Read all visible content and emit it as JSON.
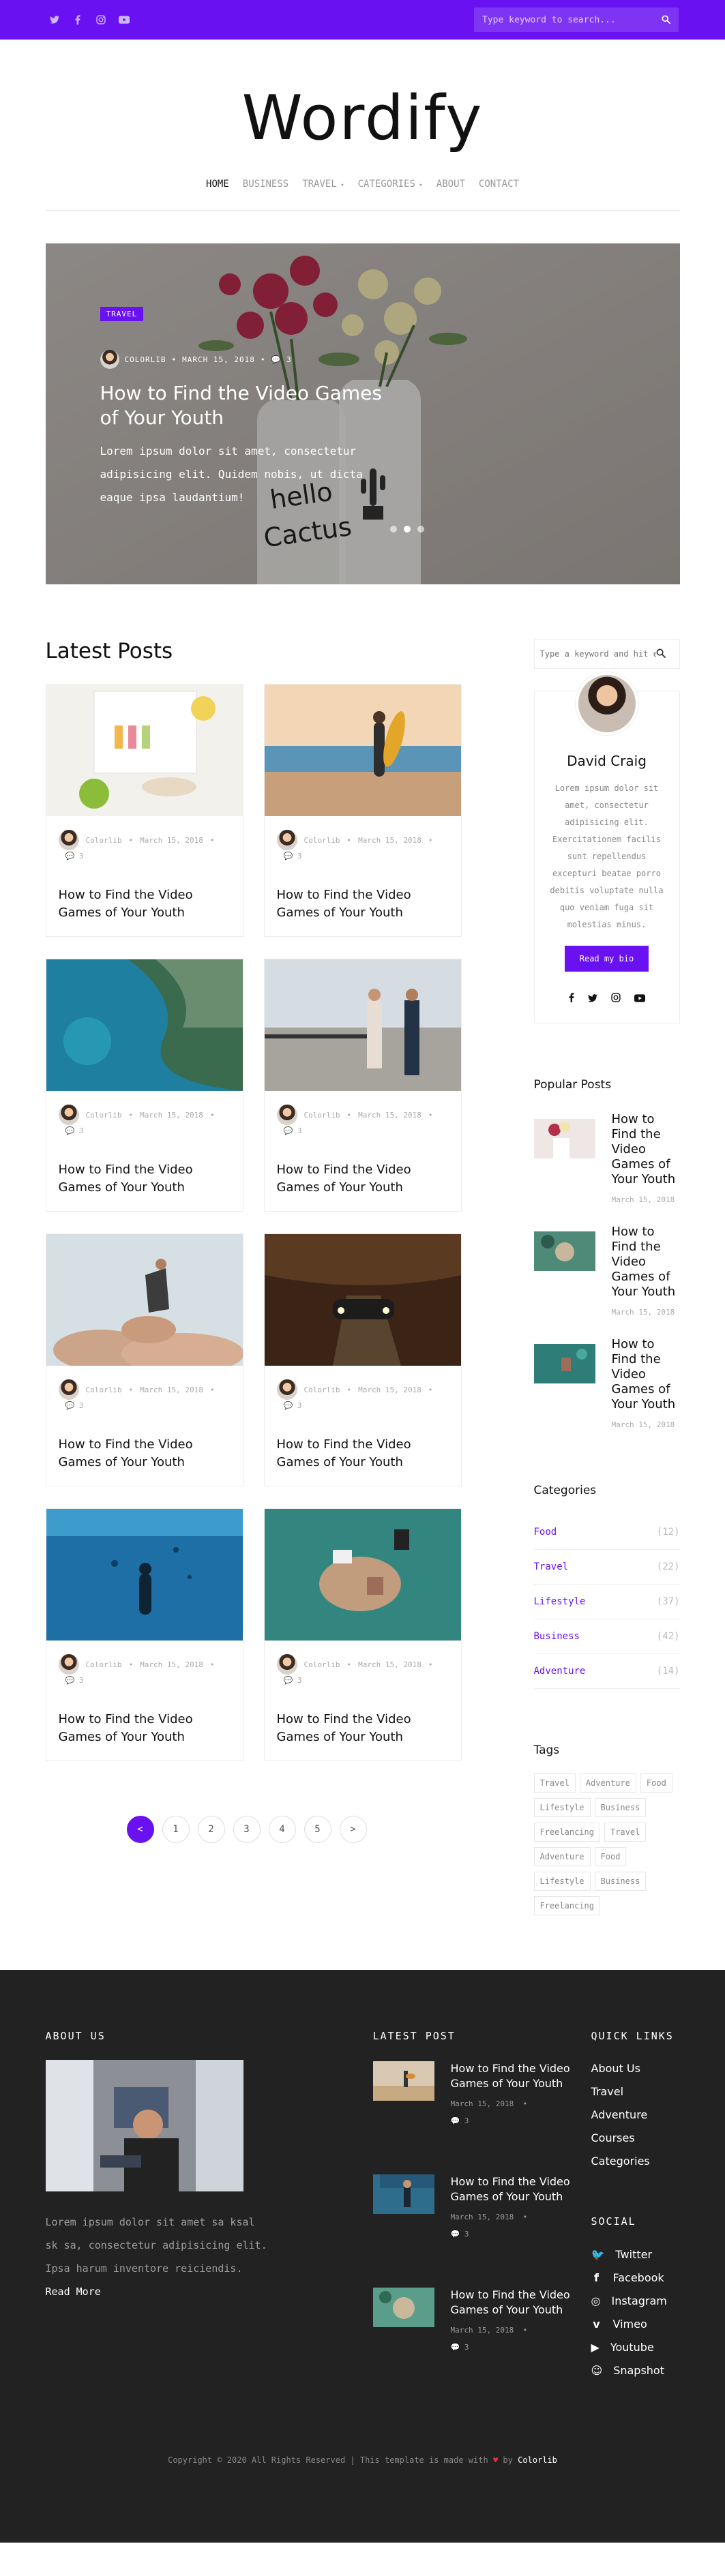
{
  "topbar": {
    "social": [
      "twitter-icon",
      "facebook-icon",
      "instagram-icon",
      "youtube-icon"
    ],
    "search_placeholder": "Type keyword to search..."
  },
  "logo": "Wordify",
  "nav": [
    {
      "label": "HOME",
      "active": true
    },
    {
      "label": "BUSINESS"
    },
    {
      "label": "TRAVEL",
      "dropdown": true
    },
    {
      "label": "CATEGORIES",
      "dropdown": true
    },
    {
      "label": "ABOUT"
    },
    {
      "label": "CONTACT"
    }
  ],
  "hero": {
    "badge": "TRAVEL",
    "author": "COLORLIB",
    "date": "MARCH 15, 2018",
    "comments": "3",
    "title": "How to Find the Video Games of Your Youth",
    "text": "Lorem ipsum dolor sit amet, consectetur adipisicing elit. Quidem nobis, ut dicta eaque ipsa laudantium!",
    "slides": 3,
    "active_slide": 2
  },
  "latest_posts": {
    "title": "Latest Posts",
    "posts": [
      {
        "author": "Colorlib",
        "date": "March 15, 2018",
        "comments": "3",
        "title": "How to Find the Video Games of Your Youth",
        "img": "food"
      },
      {
        "author": "Colorlib",
        "date": "March 15, 2018",
        "comments": "3",
        "title": "How to Find the Video Games of Your Youth",
        "img": "surf"
      },
      {
        "author": "Colorlib",
        "date": "March 15, 2018",
        "comments": "3",
        "title": "How to Find the Video Games of Your Youth",
        "img": "coast"
      },
      {
        "author": "Colorlib",
        "date": "March 15, 2018",
        "comments": "3",
        "title": "How to Find the Video Games of Your Youth",
        "img": "bridge"
      },
      {
        "author": "Colorlib",
        "date": "March 15, 2018",
        "comments": "3",
        "title": "How to Find the Video Games of Your Youth",
        "img": "rocks"
      },
      {
        "author": "Colorlib",
        "date": "March 15, 2018",
        "comments": "3",
        "title": "How to Find the Video Games of Your Youth",
        "img": "car"
      },
      {
        "author": "Colorlib",
        "date": "March 15, 2018",
        "comments": "3",
        "title": "How to Find the Video Games of Your Youth",
        "img": "diver"
      },
      {
        "author": "Colorlib",
        "date": "March 15, 2018",
        "comments": "3",
        "title": "How to Find the Video Games of Your Youth",
        "img": "aerial"
      }
    ]
  },
  "pagination": [
    "<",
    "1",
    "2",
    "3",
    "4",
    "5",
    ">"
  ],
  "sidebar": {
    "search_placeholder": "Type a keyword and hit enter",
    "bio": {
      "name": "David Craig",
      "text": "Lorem ipsum dolor sit amet, consectetur adipisicing elit. Exercitationem facilis sunt repellendus excepturi beatae porro debitis voluptate nulla quo veniam fuga sit molestias minus.",
      "button": "Read my bio",
      "social": [
        "facebook-icon",
        "twitter-icon",
        "instagram-icon",
        "youtube-icon"
      ]
    },
    "popular_title": "Popular Posts",
    "popular": [
      {
        "title": "How to Find the Video Games of Your Youth",
        "date": "March 15, 2018"
      },
      {
        "title": "How to Find the Video Games of Your Youth",
        "date": "March 15, 2018"
      },
      {
        "title": "How to Find the Video Games of Your Youth",
        "date": "March 15, 2018"
      }
    ],
    "categories_title": "Categories",
    "categories": [
      {
        "name": "Food",
        "count": "(12)"
      },
      {
        "name": "Travel",
        "count": "(22)"
      },
      {
        "name": "Lifestyle",
        "count": "(37)"
      },
      {
        "name": "Business",
        "count": "(42)"
      },
      {
        "name": "Adventure",
        "count": "(14)"
      }
    ],
    "tags_title": "Tags",
    "tags": [
      "Travel",
      "Adventure",
      "Food",
      "Lifestyle",
      "Business",
      "Freelancing",
      "Travel",
      "Adventure",
      "Food",
      "Lifestyle",
      "Business",
      "Freelancing"
    ]
  },
  "footer": {
    "about_title": "ABOUT US",
    "about_text": "Lorem ipsum dolor sit amet sa ksal sk sa, consectetur adipisicing elit. Ipsa harum inventore reiciendis.",
    "read_more": "Read More",
    "latest_title": "LATEST POST",
    "latest": [
      {
        "title": "How to Find the Video Games of Your Youth",
        "date": "March 15, 2018",
        "comments": "3"
      },
      {
        "title": "How to Find the Video Games of Your Youth",
        "date": "March 15, 2018",
        "comments": "3"
      },
      {
        "title": "How to Find the Video Games of Your Youth",
        "date": "March 15, 2018",
        "comments": "3"
      }
    ],
    "quick_title": "QUICK LINKS",
    "quick": [
      "About Us",
      "Travel",
      "Adventure",
      "Courses",
      "Categories"
    ],
    "social_title": "SOCIAL",
    "social": [
      {
        "label": "Twitter",
        "icon": "twitter-icon"
      },
      {
        "label": "Facebook",
        "icon": "facebook-icon"
      },
      {
        "label": "Instagram",
        "icon": "instagram-icon"
      },
      {
        "label": "Vimeo",
        "icon": "vimeo-icon"
      },
      {
        "label": "Youtube",
        "icon": "youtube-icon"
      },
      {
        "label": "Snapshot",
        "icon": "snapchat-icon"
      }
    ],
    "copyright_pre": "Copyright © 2020 All Rights Reserved | This template is made with",
    "copyright_by": "by",
    "copyright_brand": "Colorlib"
  },
  "colors": {
    "accent": "#6a11f1",
    "footer": "#222222"
  }
}
